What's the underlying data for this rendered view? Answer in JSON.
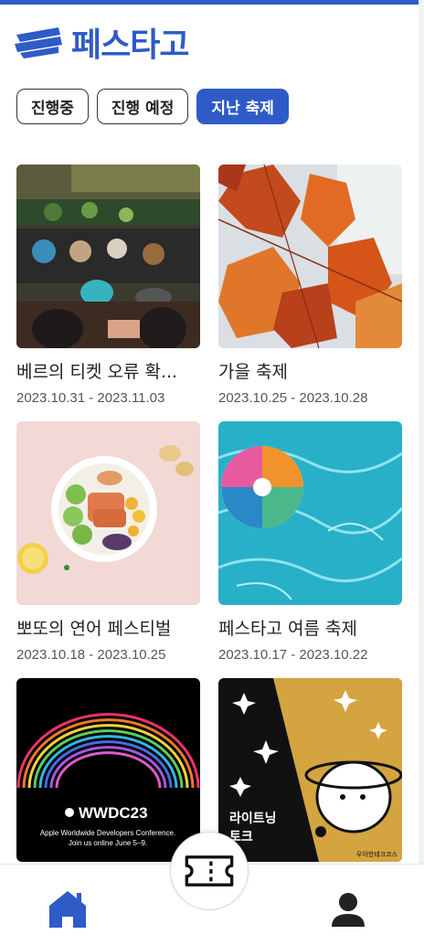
{
  "app": {
    "name": "페스타고",
    "accent": "#2e5bc7"
  },
  "filters": [
    {
      "label": "진행중",
      "active": false
    },
    {
      "label": "진행 예정",
      "active": false
    },
    {
      "label": "지난 축제",
      "active": true
    }
  ],
  "festivals": [
    {
      "title": "베르의 티켓 오류 확...",
      "dates": "2023.10.31 - 2023.11.03",
      "image": "floating-market-photo"
    },
    {
      "title": "가을 축제",
      "dates": "2023.10.25 - 2023.10.28",
      "image": "autumn-maple-leaves-photo"
    },
    {
      "title": "뽀또의 연어 페스티벌",
      "dates": "2023.10.18 - 2023.10.25",
      "image": "salmon-poke-bowl-photo"
    },
    {
      "title": "페스타고 여름 축제",
      "dates": "2023.10.17 - 2023.10.22",
      "image": "beach-ball-in-pool-photo"
    },
    {
      "title": "",
      "dates": "",
      "image": "wwdc23-poster",
      "poster_title": "WWDC23",
      "poster_sub1": "Apple Worldwide Developers Conference.",
      "poster_sub2": "Join us online June 5–9."
    },
    {
      "title": "",
      "dates": "",
      "image": "lightning-talk-poster",
      "poster_line1": "라이트닝",
      "poster_line2": "토크",
      "poster_brand": "우아한테크코스"
    }
  ],
  "nav": {
    "home_icon": "home-icon",
    "ticket_icon": "ticket-icon",
    "profile_icon": "profile-icon"
  }
}
